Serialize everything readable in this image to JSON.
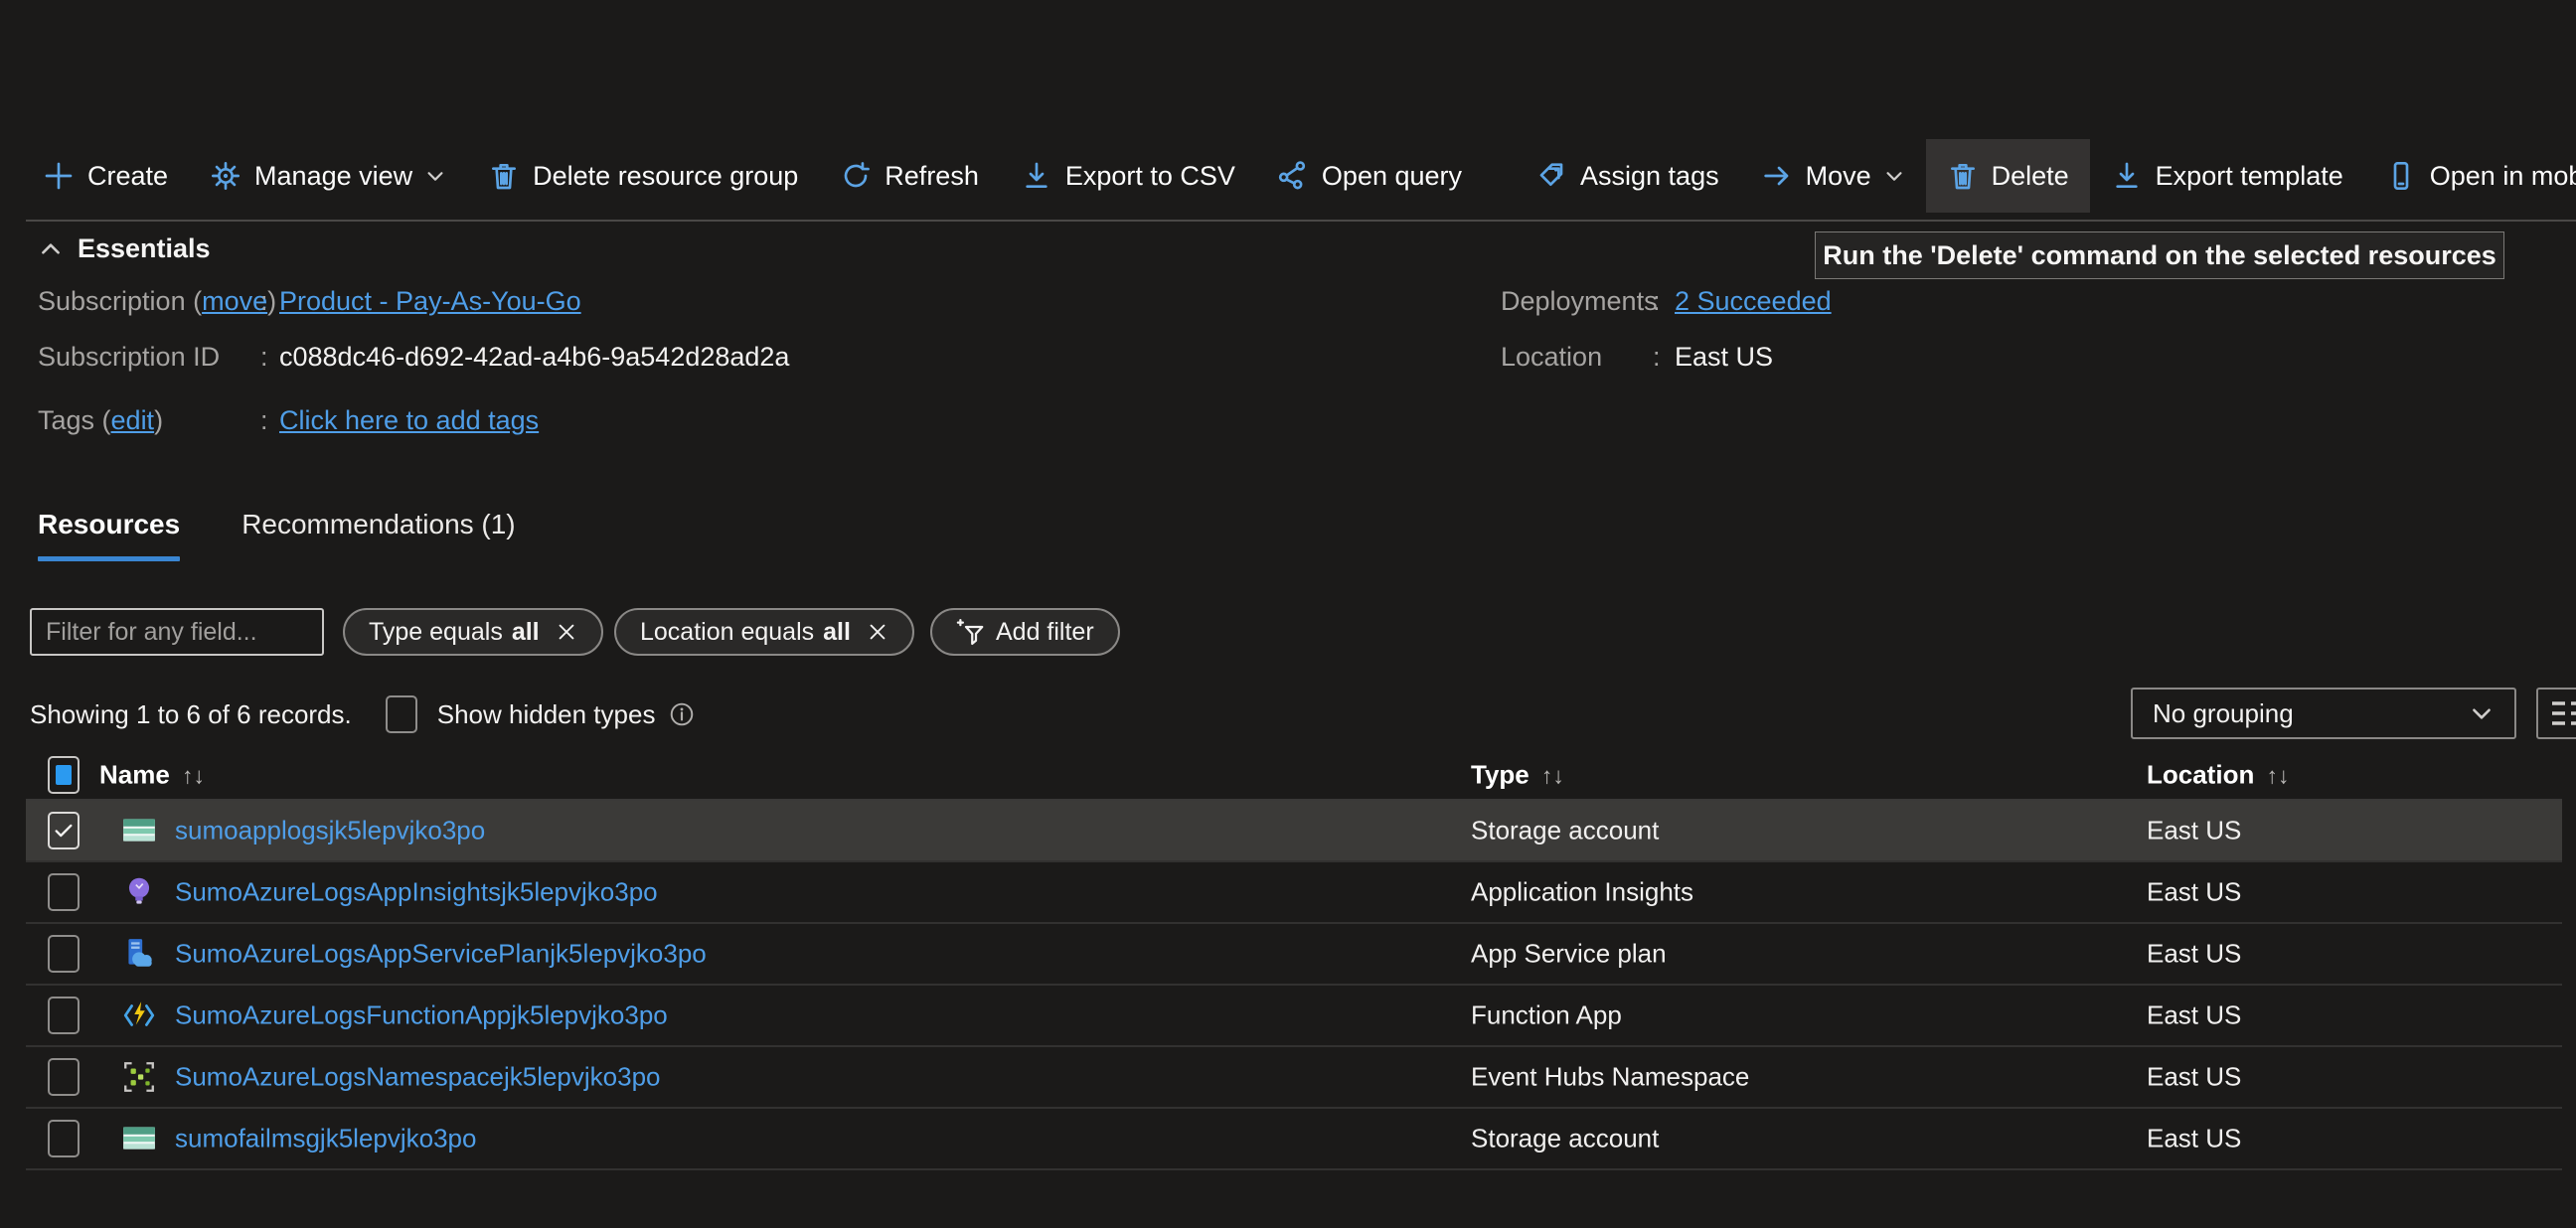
{
  "colors": {
    "accent_blue": "#5ca4e5",
    "link_blue": "#4f9ee8",
    "tab_underline": "#3a86d2",
    "selected_row_bg": "#3b3a38",
    "checkbox_fill_blue": "#2b9af0"
  },
  "toolbar": {
    "items": [
      {
        "label": "Create",
        "icon": "plus-icon"
      },
      {
        "label": "Manage view",
        "icon": "gear-icon",
        "has_chevron": true
      },
      {
        "label": "Delete resource group",
        "icon": "trash-icon"
      },
      {
        "label": "Refresh",
        "icon": "refresh-icon"
      },
      {
        "label": "Export to CSV",
        "icon": "download-icon"
      },
      {
        "label": "Open query",
        "icon": "query-graph-icon"
      },
      {
        "label": "Assign tags",
        "icon": "tags-icon"
      },
      {
        "label": "Move",
        "icon": "arrow-right-icon",
        "has_chevron": true
      },
      {
        "label": "Delete",
        "icon": "trash-icon",
        "highlighted": true
      },
      {
        "label": "Export template",
        "icon": "download-icon"
      },
      {
        "label": "Open in mobile",
        "icon": "mobile-icon"
      }
    ]
  },
  "tooltip": {
    "text": "Run the 'Delete' command on the selected resources"
  },
  "essentials": {
    "title": "Essentials",
    "subscription": {
      "prefix": "Subscription (",
      "link": "move",
      "suffix": ")",
      "colon": ":",
      "value": "Product - Pay-As-You-Go"
    },
    "subscription_id": {
      "label": "Subscription ID",
      "colon": ":",
      "value": "c088dc46-d692-42ad-a4b6-9a542d28ad2a"
    },
    "tags": {
      "prefix": "Tags (",
      "link": "edit",
      "suffix": ")",
      "colon": ":",
      "value": "Click here to add tags"
    },
    "deployments": {
      "label": "Deployments",
      "colon": ":",
      "value": "2 Succeeded"
    },
    "location": {
      "label": "Location",
      "colon": ":",
      "value": "East US"
    }
  },
  "tabs": [
    {
      "label": "Resources",
      "active": true
    },
    {
      "label": "Recommendations (1)",
      "active": false
    }
  ],
  "filters": {
    "search_placeholder": "Filter for any field...",
    "pills": [
      {
        "text": "Type equals",
        "bold": "all"
      },
      {
        "text": "Location equals",
        "bold": "all"
      }
    ],
    "add_filter_label": "Add filter"
  },
  "records_bar": {
    "showing_text": "Showing 1 to 6 of 6 records.",
    "show_hidden_label": "Show hidden types",
    "grouping_value": "No grouping"
  },
  "table": {
    "columns": {
      "name": "Name",
      "type": "Type",
      "location": "Location",
      "sort_glyph": "↑↓"
    },
    "rows": [
      {
        "name": "sumoapplogsjk5lepvjko3po",
        "type": "Storage account",
        "location": "East US",
        "icon": "storage-account",
        "selected": true,
        "checked": true
      },
      {
        "name": "SumoAzureLogsAppInsightsjk5lepvjko3po",
        "type": "Application Insights",
        "location": "East US",
        "icon": "application-insights",
        "selected": false,
        "checked": false
      },
      {
        "name": "SumoAzureLogsAppServicePlanjk5lepvjko3po",
        "type": "App Service plan",
        "location": "East US",
        "icon": "app-service-plan",
        "selected": false,
        "checked": false
      },
      {
        "name": "SumoAzureLogsFunctionAppjk5lepvjko3po",
        "type": "Function App",
        "location": "East US",
        "icon": "function-app",
        "selected": false,
        "checked": false
      },
      {
        "name": "SumoAzureLogsNamespacejk5lepvjko3po",
        "type": "Event Hubs Namespace",
        "location": "East US",
        "icon": "event-hubs-namespace",
        "selected": false,
        "checked": false
      },
      {
        "name": "sumofailmsgjk5lepvjko3po",
        "type": "Storage account",
        "location": "East US",
        "icon": "storage-account",
        "selected": false,
        "checked": false
      }
    ]
  }
}
